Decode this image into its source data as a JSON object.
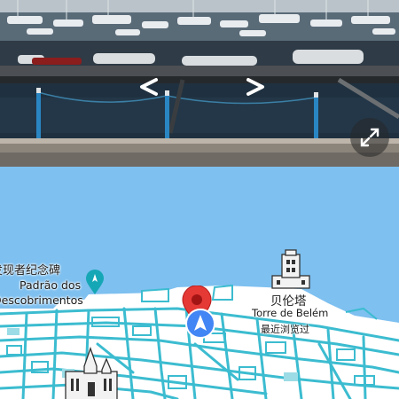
{
  "photo": {
    "left_arrow_icon": "chevron-left-icon",
    "right_arrow_icon": "chevron-right-icon",
    "expand_icon": "expand-diagonal-icon"
  },
  "map": {
    "padrao": {
      "name_zh": "发现者纪念碑",
      "name_line1": "Padrão dos",
      "name_line2": "Descobrimentos"
    },
    "torre": {
      "name_zh": "贝伦塔",
      "name_en": "Torre de Belém",
      "recent": "最近浏览过"
    },
    "colors": {
      "water": "#7ec0f0",
      "land": "#ffffff",
      "roads": "#3cbcd0",
      "pin": "#e53935",
      "location": "#4285f4"
    },
    "icons": [
      "location-pin-icon",
      "my-location-arrow-icon",
      "monument-icon",
      "tower-icon",
      "church-icon"
    ]
  }
}
